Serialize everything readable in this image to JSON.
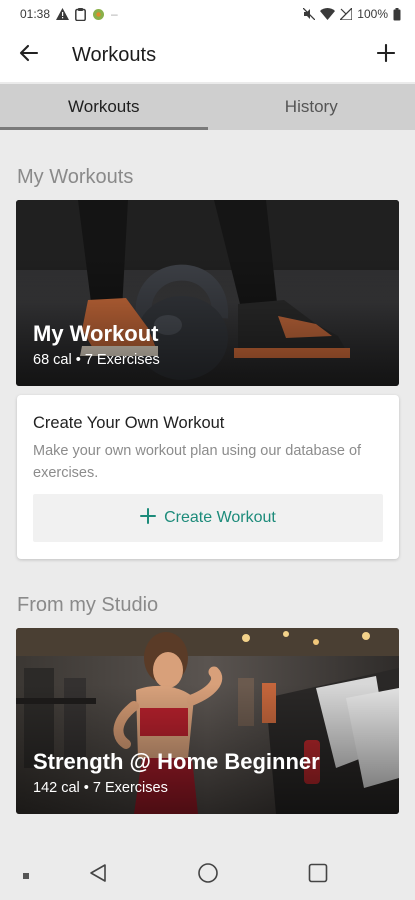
{
  "status_bar": {
    "time": "01:38",
    "battery": "100%",
    "icons": [
      "alert-icon",
      "clipboard-icon",
      "app-icon",
      "mute-icon",
      "wifi-icon",
      "signal-icon",
      "battery-icon"
    ]
  },
  "app_bar": {
    "title": "Workouts",
    "back_icon": "back-arrow-icon",
    "add_icon": "plus-icon"
  },
  "tabs": [
    {
      "label": "Workouts",
      "active": true
    },
    {
      "label": "History",
      "active": false
    }
  ],
  "my_workouts": {
    "heading": "My Workouts",
    "card": {
      "title": "My Workout",
      "meta": "68 cal • 7 Exercises"
    }
  },
  "create_card": {
    "title": "Create Your Own Workout",
    "description": "Make your own workout plan using our database of exercises.",
    "button_label": "Create Workout",
    "accent": "#1c8b7a"
  },
  "studio": {
    "heading": "From my Studio",
    "card": {
      "title": "Strength @ Home Beginner",
      "meta": "142 cal • 7 Exercises"
    }
  },
  "nav_bar": {
    "icons": [
      "recents-dot-icon",
      "back-triangle-icon",
      "home-circle-icon",
      "overview-square-icon"
    ]
  }
}
